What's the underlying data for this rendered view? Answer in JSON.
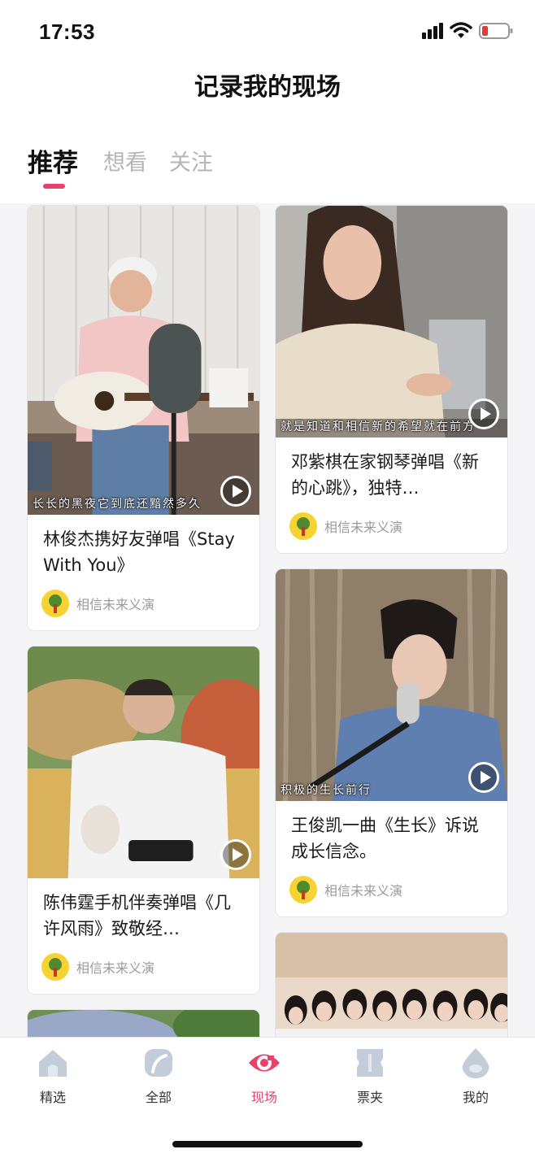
{
  "status": {
    "time": "17:53"
  },
  "header": {
    "title": "记录我的现场"
  },
  "tabs": [
    {
      "label": "推荐",
      "active": true
    },
    {
      "label": "想看",
      "active": false
    },
    {
      "label": "关注",
      "active": false
    }
  ],
  "accent_color": "#e8416b",
  "cards": [
    {
      "title": "林俊杰携好友弹唱《Stay With You》",
      "subtitle": "长长的黑夜它到底还黯然多久",
      "author": "相信未来义演"
    },
    {
      "title": "邓紫棋在家钢琴弹唱《新的心跳》，独特…",
      "subtitle": "就是知道和相信新的希望就在前方",
      "author": "相信未来义演"
    },
    {
      "title": "陈伟霆手机伴奏弹唱《几许风雨》致敬经…",
      "subtitle": "",
      "author": "相信未来义演"
    },
    {
      "title": "王俊凯一曲《生长》诉说成长信念。",
      "subtitle": "积极的生长前行",
      "author": "相信未来义演"
    }
  ],
  "nav": [
    {
      "label": "精选",
      "icon": "home-icon",
      "active": false
    },
    {
      "label": "全部",
      "icon": "leaf-icon",
      "active": false
    },
    {
      "label": "现场",
      "icon": "eye-icon",
      "active": true
    },
    {
      "label": "票夹",
      "icon": "ticket-icon",
      "active": false
    },
    {
      "label": "我的",
      "icon": "profile-drop-icon",
      "active": false
    }
  ]
}
